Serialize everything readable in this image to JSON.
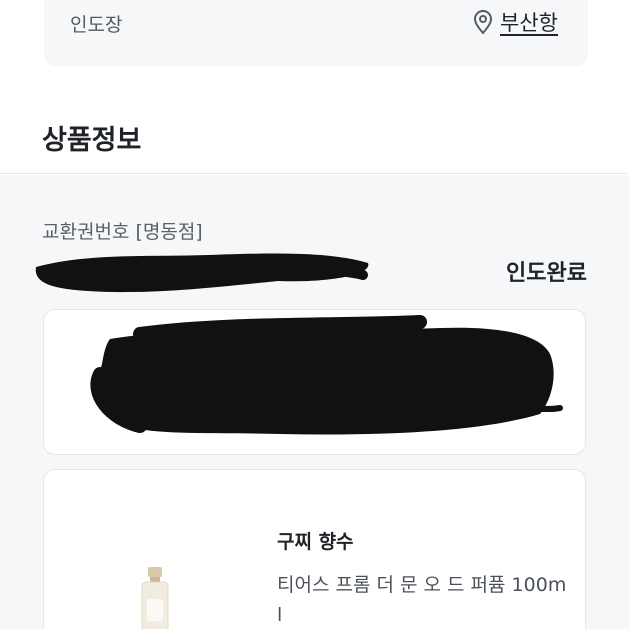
{
  "pickup": {
    "label": "인도장",
    "place": "부산항",
    "icon": "location-pin-icon"
  },
  "section": {
    "title": "상품정보"
  },
  "order": {
    "voucher_label": "교환권번호 [명동점]",
    "status": "인도완료"
  },
  "product": {
    "name": "구찌 향수",
    "description": "티어스 프롬 더 문 오 드 퍼퓸 100ml"
  },
  "colors": {
    "background": "#f6f7f9",
    "card": "#ffffff",
    "text": "#1f2328",
    "muted": "#5a6068",
    "redaction": "#111111"
  }
}
